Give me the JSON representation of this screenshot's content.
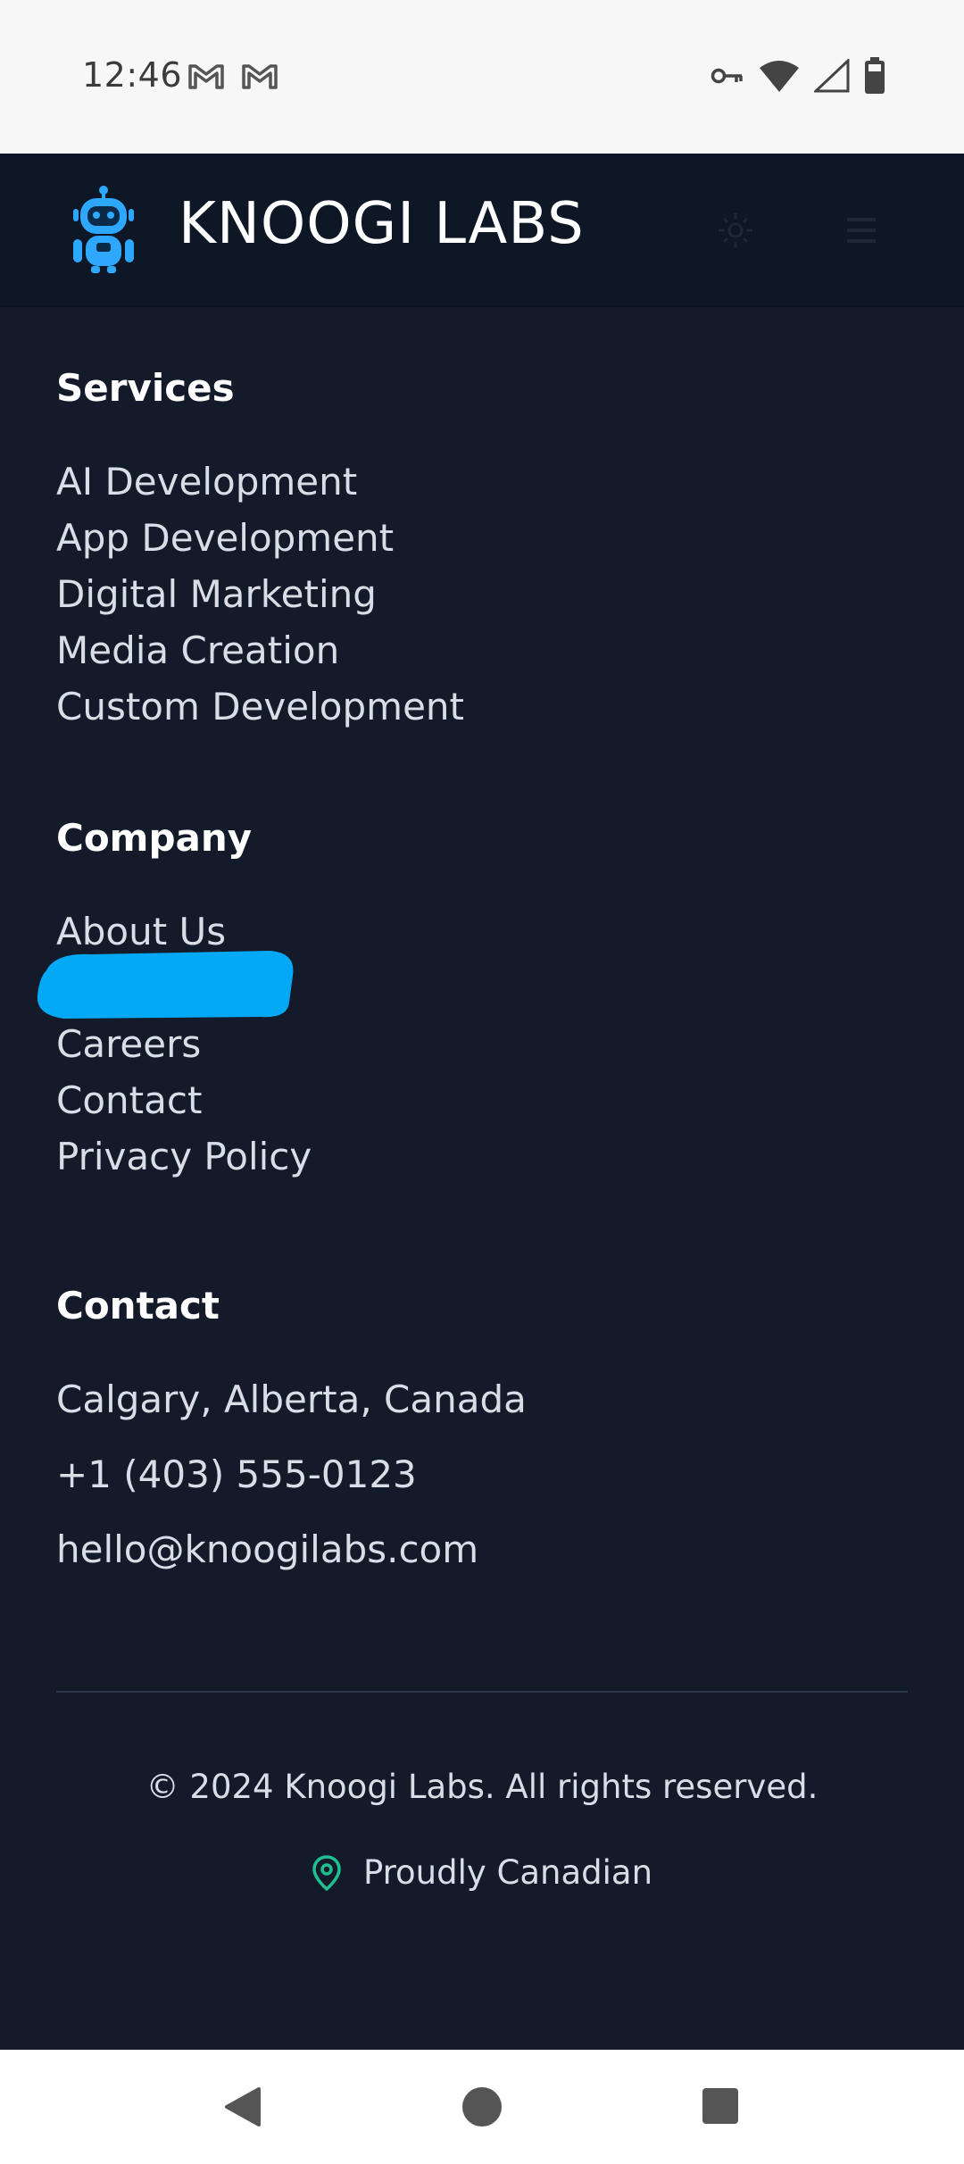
{
  "status_bar": {
    "time": "12:46",
    "left_icons": [
      "gmail-icon",
      "gmail-icon"
    ],
    "right_icons": [
      "vpn-key-icon",
      "wifi-icon",
      "cell-signal-icon",
      "battery-icon"
    ]
  },
  "header": {
    "brand": "KNOOGI LABS",
    "logo_icon": "robot-icon",
    "theme_icon": "sun-icon",
    "menu_icon": "hamburger-menu-icon",
    "logo_color": "#2ea8ff"
  },
  "footer": {
    "services": {
      "heading": "Services",
      "items": [
        "AI Development",
        "App Development",
        "Digital Marketing",
        "Media Creation",
        "Custom Development"
      ]
    },
    "company": {
      "heading": "Company",
      "items": [
        "About Us",
        "",
        "Careers",
        "Contact",
        "Privacy Policy"
      ]
    },
    "contact": {
      "heading": "Contact",
      "location": "Calgary, Alberta, Canada",
      "phone": "+1 (403) 555-0123",
      "email": "hello@knoogilabs.com"
    },
    "copyright": "© 2024 Knoogi Labs. All rights reserved.",
    "proudly": "Proudly Canadian",
    "proudly_icon": "map-pin-icon",
    "accent_green": "#1fbf8f"
  },
  "nav_bar": {
    "icons": [
      "back-icon",
      "home-icon",
      "recents-icon"
    ]
  },
  "colors": {
    "background": "#131a2a",
    "header_bg": "#0d1726",
    "redaction": "#03a9f4"
  }
}
